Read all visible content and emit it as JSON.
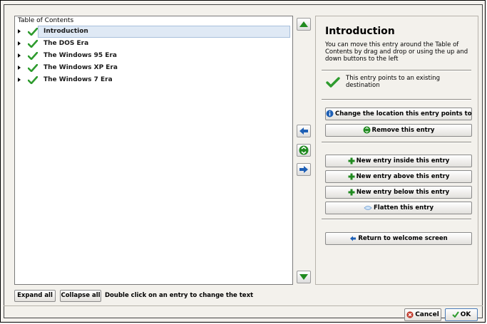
{
  "toc": {
    "header": "Table of Contents",
    "entries": [
      {
        "label": "Introduction",
        "selected": true
      },
      {
        "label": "The DOS Era",
        "selected": false
      },
      {
        "label": "The Windows 95 Era",
        "selected": false
      },
      {
        "label": "The Windows XP Era",
        "selected": false
      },
      {
        "label": "The Windows 7 Era",
        "selected": false
      }
    ]
  },
  "entry_panel": {
    "title": "Introduction",
    "description": "You can move this entry around the Table of Contents by drag and drop or using the up and down buttons to the left",
    "status_text": "This entry points to an existing destination",
    "buttons": {
      "change_location": "Change the location this entry points to",
      "remove": "Remove this entry",
      "new_inside": "New entry inside this entry",
      "new_above": "New entry above this entry",
      "new_below": "New entry below this entry",
      "flatten": "Flatten this entry",
      "return": "Return to welcome screen"
    }
  },
  "bottom": {
    "expand_all": "Expand all",
    "collapse_all": "Collapse all",
    "hint": "Double click on an entry to change the text"
  },
  "dialog": {
    "cancel": "Cancel",
    "ok": "OK"
  },
  "icons": {
    "move_up": "arrow-up-icon",
    "move_down": "arrow-down-icon",
    "dedent": "arrow-left-icon",
    "indent": "arrow-right-icon",
    "remove": "recycle-icon",
    "entry_ok": "checkmark-icon"
  },
  "colors": {
    "check_green": "#2e9b2e",
    "arrow_blue": "#1d5fb5",
    "arrow_green": "#1f8a1f",
    "selection": "#dfe9f5",
    "cancel_red": "#c0392b"
  }
}
